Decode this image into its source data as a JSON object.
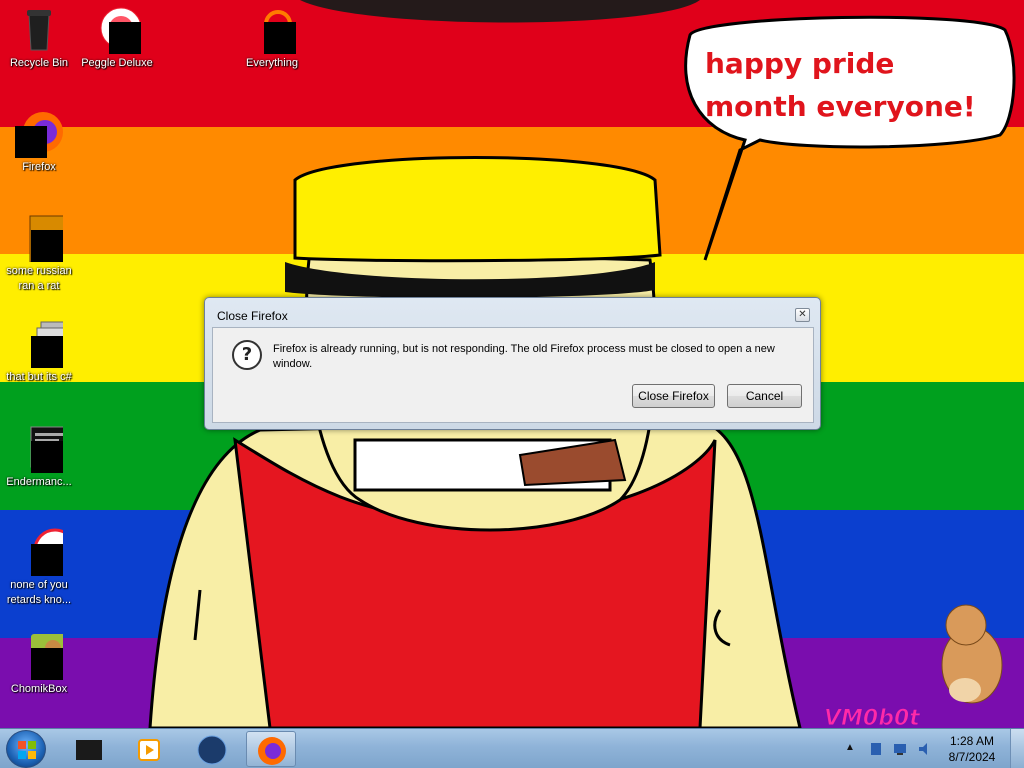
{
  "wallpaper": {
    "stripe_colors": [
      "#e0001a",
      "#ff8a00",
      "#ffee00",
      "#00a01e",
      "#0b3fcf",
      "#7a0dae"
    ],
    "bubble_text": "happy pride month everyone!",
    "watermark": "VM0b0t"
  },
  "desktop": {
    "icons": [
      {
        "label": "Recycle Bin",
        "icon": "recycle-bin-icon"
      },
      {
        "label": "Peggle Deluxe",
        "icon": "peggle-icon"
      },
      {
        "label": "Everything",
        "icon": "everything-search-icon"
      },
      {
        "label": "Firefox",
        "icon": "firefox-icon"
      },
      {
        "label": "some russian ran a rat",
        "icon": "app-icon"
      },
      {
        "label": "that but its c#",
        "icon": "app-stack-icon"
      },
      {
        "label": "Endermanc...",
        "icon": "terminal-icon"
      },
      {
        "label": "none of you retards kno...",
        "icon": "app-icon"
      },
      {
        "label": "ChomikBox",
        "icon": "chomikbox-icon"
      }
    ]
  },
  "dialog": {
    "title": "Close Firefox",
    "message": "Firefox is already running, but is not responding. The old Firefox process must be closed to open a new window.",
    "buttons": {
      "primary": "Close Firefox",
      "secondary": "Cancel"
    },
    "icon": "question-icon",
    "close_glyph": "✕"
  },
  "taskbar": {
    "pinned": [
      "media-player-icon",
      "windows-media-player-icon",
      "browser-icon",
      "firefox-icon"
    ],
    "tray": {
      "expand_glyph": "▲",
      "time": "1:28 AM",
      "date": "8/7/2024"
    }
  }
}
